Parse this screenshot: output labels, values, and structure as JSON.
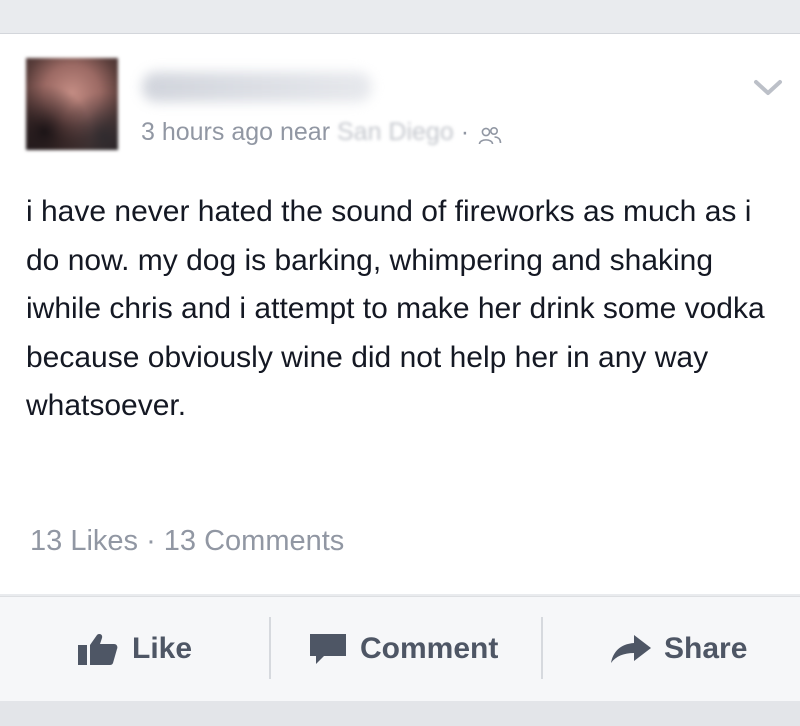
{
  "post": {
    "time": "3 hours ago near",
    "location": "San Diego",
    "separator": "·",
    "text": "i have never hated the sound of fireworks as much as i do now. my dog is barking, whimpering and shaking iwhile chris and i attempt to make her drink some vodka because obviously wine did not help her in any way whatsoever.",
    "likes": "13 Likes",
    "comments": "13 Comments",
    "stats_separator": " · "
  },
  "actions": {
    "like": "Like",
    "comment": "Comment",
    "share": "Share"
  },
  "icons": {
    "audience": "friends-icon",
    "menu": "chevron-down-icon",
    "like": "thumbs-up-icon",
    "comment": "speech-bubble-icon",
    "share": "share-arrow-icon"
  },
  "colors": {
    "text": "#141823",
    "meta": "#9197a3",
    "action": "#4e5665",
    "background": "#e9ebee"
  }
}
